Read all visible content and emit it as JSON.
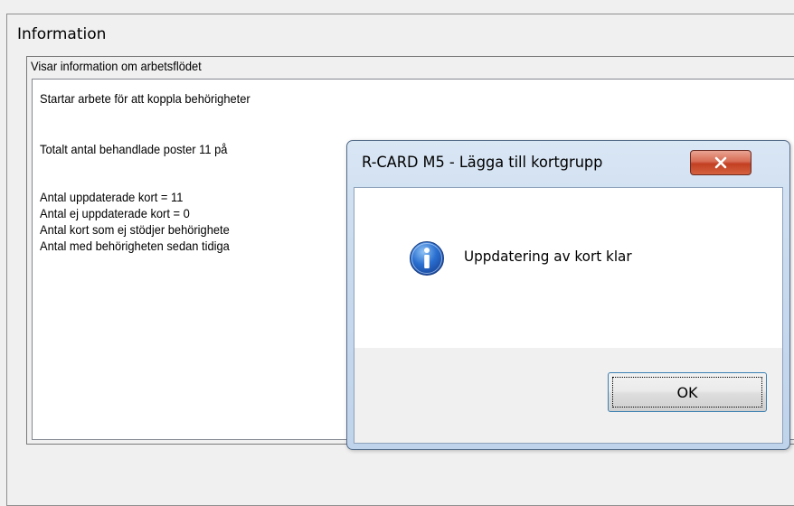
{
  "window": {
    "section_title": "Information",
    "group_label": "Visar information om arbetsflödet",
    "log_lines": [
      "Startar arbete för att koppla behörigheter",
      "Totalt antal behandlade poster 11 på",
      "Antal uppdaterade kort = 11",
      "Antal ej uppdaterade kort = 0",
      "Antal kort som ej stödjer behörighete",
      "Antal med behörigheten sedan tidiga"
    ]
  },
  "dialog": {
    "title": "R-CARD M5 - Lägga till kortgrupp",
    "close_label": "x",
    "message": "Uppdatering av kort klar",
    "icon": "info-icon",
    "ok_label": "OK"
  },
  "colors": {
    "window_bg": "#f0f0f0",
    "dialog_frame": "#c9daee",
    "close_button": "#c94f33",
    "ok_border": "#3c7fb1"
  }
}
